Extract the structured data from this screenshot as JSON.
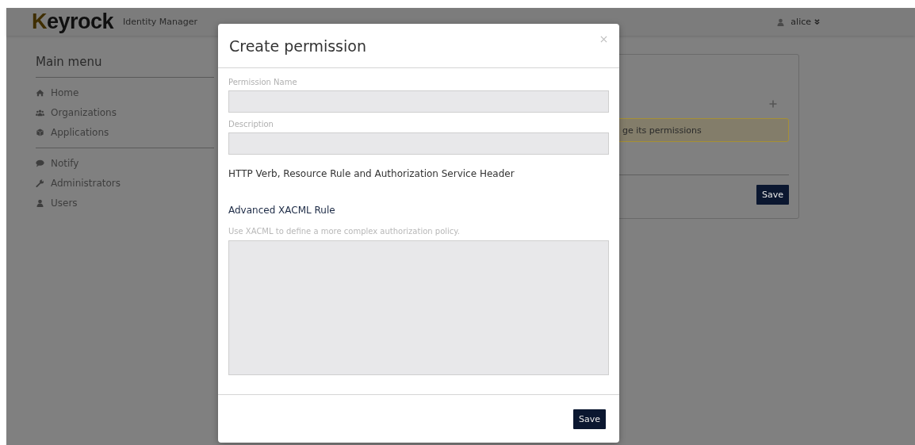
{
  "header": {
    "logo": "Keyrock",
    "subtitle": "Identity Manager",
    "user": "alice"
  },
  "sidebar": {
    "title": "Main menu",
    "groups": [
      [
        {
          "label": "Home"
        },
        {
          "label": "Organizations"
        },
        {
          "label": "Applications"
        }
      ],
      [
        {
          "label": "Notify"
        },
        {
          "label": "Administrators"
        },
        {
          "label": "Users"
        }
      ]
    ]
  },
  "background_panel": {
    "alert": "ge its permissions",
    "button": "Save"
  },
  "modal": {
    "title": "Create permission",
    "fields": [
      {
        "label": "Permission Name"
      },
      {
        "label": "Description"
      }
    ],
    "section_heading": "HTTP Verb, Resource Rule and Authorization Service Header",
    "advanced_heading": "Advanced XACML Rule",
    "advanced_hint": "Use XACML to define a more complex authorization policy.",
    "button": "Save"
  }
}
